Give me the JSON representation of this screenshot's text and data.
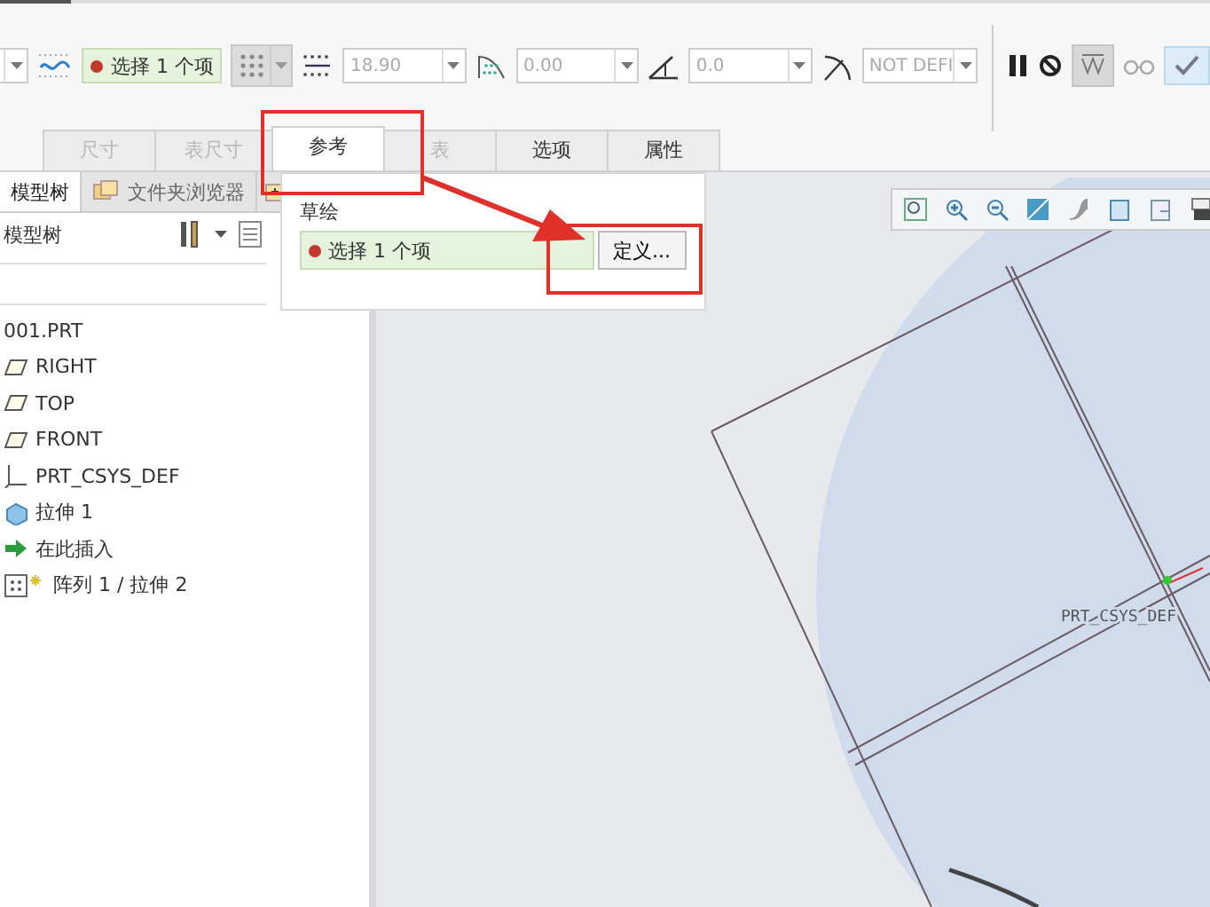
{
  "toolbar": {
    "reference_field": {
      "text": "选择 1 个项"
    },
    "spacing_field": {
      "value": "18.90"
    },
    "offset_field": {
      "value": "0.00"
    },
    "angle_field": {
      "value": "0.0"
    },
    "radius_field": {
      "value": "NOT DEFI"
    }
  },
  "tabs": [
    {
      "label": "尺寸",
      "selected": false,
      "disabled": true
    },
    {
      "label": "表尺寸",
      "selected": false,
      "disabled": true
    },
    {
      "label": "参考",
      "selected": true,
      "disabled": false
    },
    {
      "label": "表",
      "selected": false,
      "disabled": true
    },
    {
      "label": "选项",
      "selected": false,
      "disabled": false
    },
    {
      "label": "属性",
      "selected": false,
      "disabled": false
    }
  ],
  "reference_panel": {
    "label": "草绘",
    "field": "选择 1 个项",
    "button": "定义..."
  },
  "left_tabs": [
    {
      "label": "模型树",
      "selected": true
    },
    {
      "label": "文件夹浏览器",
      "selected": false
    }
  ],
  "tree_header": "模型树",
  "tree": {
    "label": "001.PRT",
    "children": [
      {
        "label": "RIGHT",
        "kind": "plane"
      },
      {
        "label": "TOP",
        "kind": "plane"
      },
      {
        "label": "FRONT",
        "kind": "plane"
      },
      {
        "label": "PRT_CSYS_DEF",
        "kind": "csys"
      },
      {
        "label": "拉伸 1",
        "kind": "extrude"
      },
      {
        "label": "在此插入",
        "kind": "insert"
      },
      {
        "label": "阵列 1 / 拉伸 2",
        "kind": "pattern"
      }
    ]
  },
  "canvas": {
    "csys_label": "PRT_CSYS_DEF"
  }
}
